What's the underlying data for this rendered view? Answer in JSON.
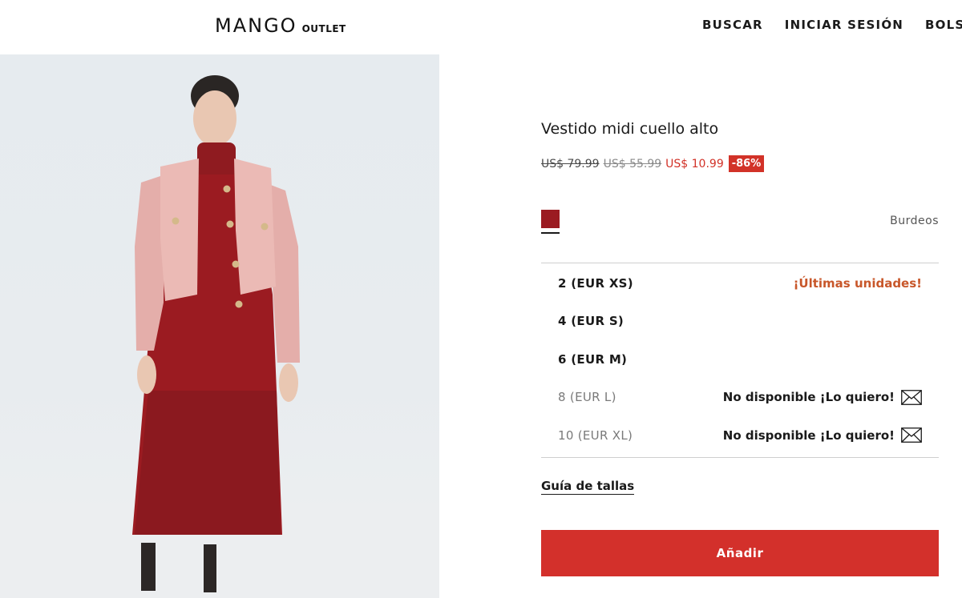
{
  "header": {
    "logo_main": "MANGO",
    "logo_sub": "OUTLET",
    "nav": [
      "BUSCAR",
      "INICIAR SESIÓN",
      "BOLSA"
    ]
  },
  "product": {
    "title": "Vestido midi cuello alto",
    "price_original": "US$ 79.99",
    "price_previous": "US$ 55.99",
    "price_current": "US$ 10.99",
    "discount": "-86%",
    "color_name": "Burdeos",
    "color_hex": "#9b1b21",
    "sizes": [
      {
        "label": "2 (EUR XS)",
        "note": "¡Últimas unidades!",
        "available": true
      },
      {
        "label": "4 (EUR S)",
        "note": "",
        "available": true
      },
      {
        "label": "6 (EUR M)",
        "note": "",
        "available": true
      },
      {
        "label": "8 (EUR L)",
        "note": "No disponible ¡Lo quiero!",
        "available": false
      },
      {
        "label": "10 (EUR XL)",
        "note": "No disponible ¡Lo quiero!",
        "available": false
      }
    ],
    "size_guide_label": "Guía de tallas",
    "add_button_label": "Añadir"
  },
  "colors": {
    "accent": "#d3302b",
    "low_stock": "#c8572a",
    "dress": "#9b1b21",
    "jacket": "#e8b4b0"
  },
  "icons": {
    "notify": "envelope-icon"
  }
}
